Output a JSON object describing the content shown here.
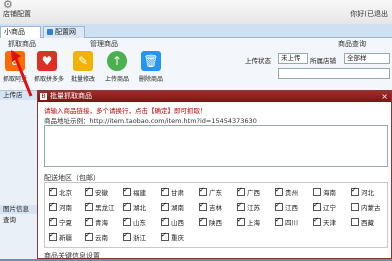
{
  "app": {
    "title": "店铺配置",
    "user_text": "你好(已退出"
  },
  "tabs": [
    {
      "label": "小商品"
    },
    {
      "label": "配置网店"
    }
  ],
  "ribbon": {
    "group_grab": "抓取商品",
    "group_manage": "管理商品",
    "group_query": "商品查询",
    "buttons": [
      {
        "label": "抓取阿里",
        "icon": "alibaba-icon",
        "color": "#ff6a00"
      },
      {
        "label": "抓取拼多多",
        "icon": "pinduoduo-icon",
        "color": "#e02e24"
      },
      {
        "label": "批量修改",
        "icon": "edit-icon",
        "color": "#f0b400"
      },
      {
        "label": "上传商品",
        "icon": "upload-icon",
        "color": "#4caf50"
      },
      {
        "label": "删除商品",
        "icon": "delete-icon",
        "color": "#2196f3"
      }
    ],
    "upload_status_label": "上传状态",
    "upload_status_value": "未上传",
    "category_label": "所属店铺",
    "category_value": "全部样"
  },
  "left_pane": {
    "upload_label": "上传店",
    "image_label": "图片信息",
    "other_label": "查询"
  },
  "dialog": {
    "title": "批量抓取商品",
    "prompt": "请输入商品链接，多个请换行，点击【确定】即可抓取！",
    "url_example": "商品地址示例：http://item.taobao.com/item.htm?id=15454373630",
    "region_title": "配送地区（包邮）",
    "provinces": [
      [
        "北京",
        "安徽",
        "福建",
        "甘肃",
        "广东",
        "广西",
        "贵州",
        "海南",
        "河北"
      ],
      [
        "河南",
        "黑龙江",
        "湖北",
        "湖南",
        "吉林",
        "江苏",
        "江西",
        "辽宁",
        "内蒙古"
      ],
      [
        "宁夏",
        "青海",
        "山东",
        "山西",
        "陕西",
        "上海",
        "四川",
        "天津",
        "西藏"
      ],
      [
        "新疆",
        "云南",
        "浙江",
        "重庆"
      ]
    ],
    "unchecked": [
      "海南",
      "内蒙古",
      "西藏"
    ],
    "keyword_title": "商品关键信息设置"
  }
}
